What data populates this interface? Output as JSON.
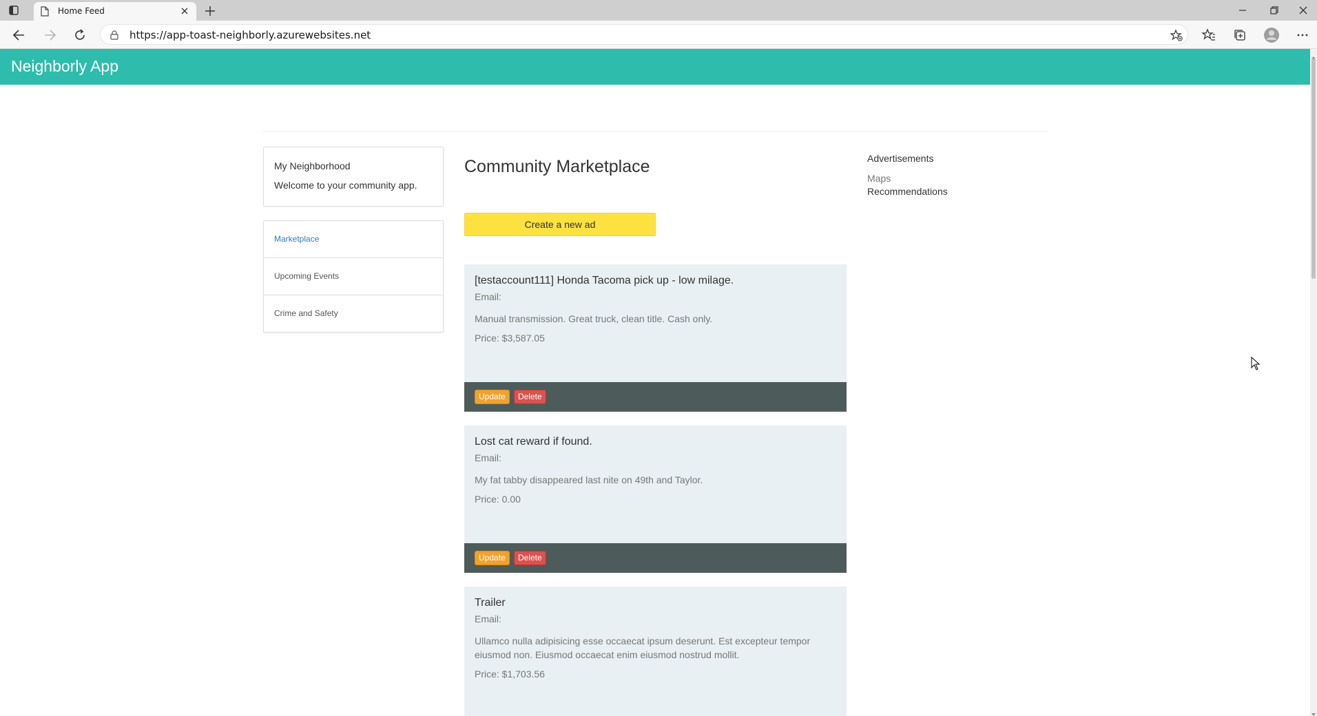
{
  "browser": {
    "tab_title": "Home Feed",
    "url": "https://app-toast-neighborly.azurewebsites.net"
  },
  "navbar": {
    "brand": "Neighborly App",
    "color": "#2ebdac"
  },
  "sidebar": {
    "welcome_title": "My Neighborhood",
    "welcome_text": "Welcome to your community app.",
    "items": [
      {
        "label": "Marketplace",
        "active": true
      },
      {
        "label": "Upcoming Events",
        "active": false
      },
      {
        "label": "Crime and Safety",
        "active": false
      }
    ]
  },
  "main": {
    "heading": "Community Marketplace",
    "create_button": "Create a new ad",
    "email_label": "Email:",
    "update_label": "Update",
    "delete_label": "Delete",
    "ads": [
      {
        "title": "[testaccount111] Honda Tacoma pick up - low milage.",
        "description": "Manual transmission. Great truck, clean title. Cash only.",
        "price": "Price: $3,587.05"
      },
      {
        "title": "Lost cat reward if found.",
        "description": "My fat tabby disappeared last nite on 49th and Taylor.",
        "price": "Price: 0.00"
      },
      {
        "title": "Trailer",
        "description": "Ullamco nulla adipisicing esse occaecat ipsum deserunt. Est excepteur tempor eiusmod non. Eiusmod occaecat enim eiusmod nostrud mollit.",
        "price": "Price: $1,703.56"
      }
    ]
  },
  "advertisements": {
    "title": "Advertisements",
    "maps": "Maps",
    "recommendations": "Recommendations"
  }
}
